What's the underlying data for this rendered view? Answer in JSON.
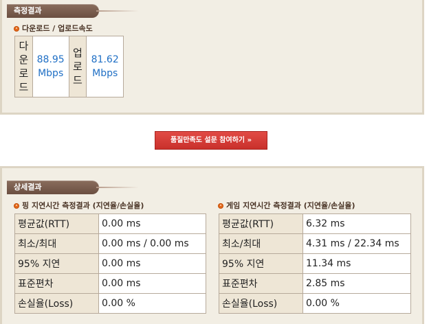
{
  "measurement": {
    "tab_label": "측정결과",
    "sub_title": "다운로드 / 업로드속도",
    "download": {
      "label_chars": [
        "다",
        "운",
        "로",
        "드"
      ],
      "value": "88.95",
      "unit": "Mbps"
    },
    "upload": {
      "label_chars": [
        "업",
        "로",
        "드"
      ],
      "value": "81.62",
      "unit": "Mbps"
    }
  },
  "survey": {
    "button_label": "품질만족도 설문 참여하기 »"
  },
  "details": {
    "tab_label": "상세결과",
    "ping": {
      "title": "핑 지연시간 측정결과 (지연율/손실율)",
      "rows": [
        {
          "label": "평균값(RTT)",
          "value": "0.00 ms"
        },
        {
          "label": "최소/최대",
          "value": "0.00 ms / 0.00 ms"
        },
        {
          "label": "95% 지연",
          "value": "0.00 ms"
        },
        {
          "label": "표준편차",
          "value": "0.00 ms"
        },
        {
          "label": "손실율(Loss)",
          "value": "0.00 %"
        }
      ]
    },
    "game": {
      "title": "게임 지연시간 측정결과 (지연율/손실율)",
      "rows": [
        {
          "label": "평균값(RTT)",
          "value": "6.32 ms"
        },
        {
          "label": "최소/최대",
          "value": "4.31 ms / 22.34 ms"
        },
        {
          "label": "95% 지연",
          "value": "11.34 ms"
        },
        {
          "label": "표준편차",
          "value": "2.85 ms"
        },
        {
          "label": "손실율(Loss)",
          "value": "0.00 %"
        }
      ]
    }
  },
  "colors": {
    "panel_bg": "#f2eee4",
    "tab_bg": "#7a5d4e",
    "label_cell_bg": "#eee6d6",
    "speed_value": "#1f6fc5",
    "button_bg": "#d63c36",
    "bullet": "#e46a1e"
  }
}
